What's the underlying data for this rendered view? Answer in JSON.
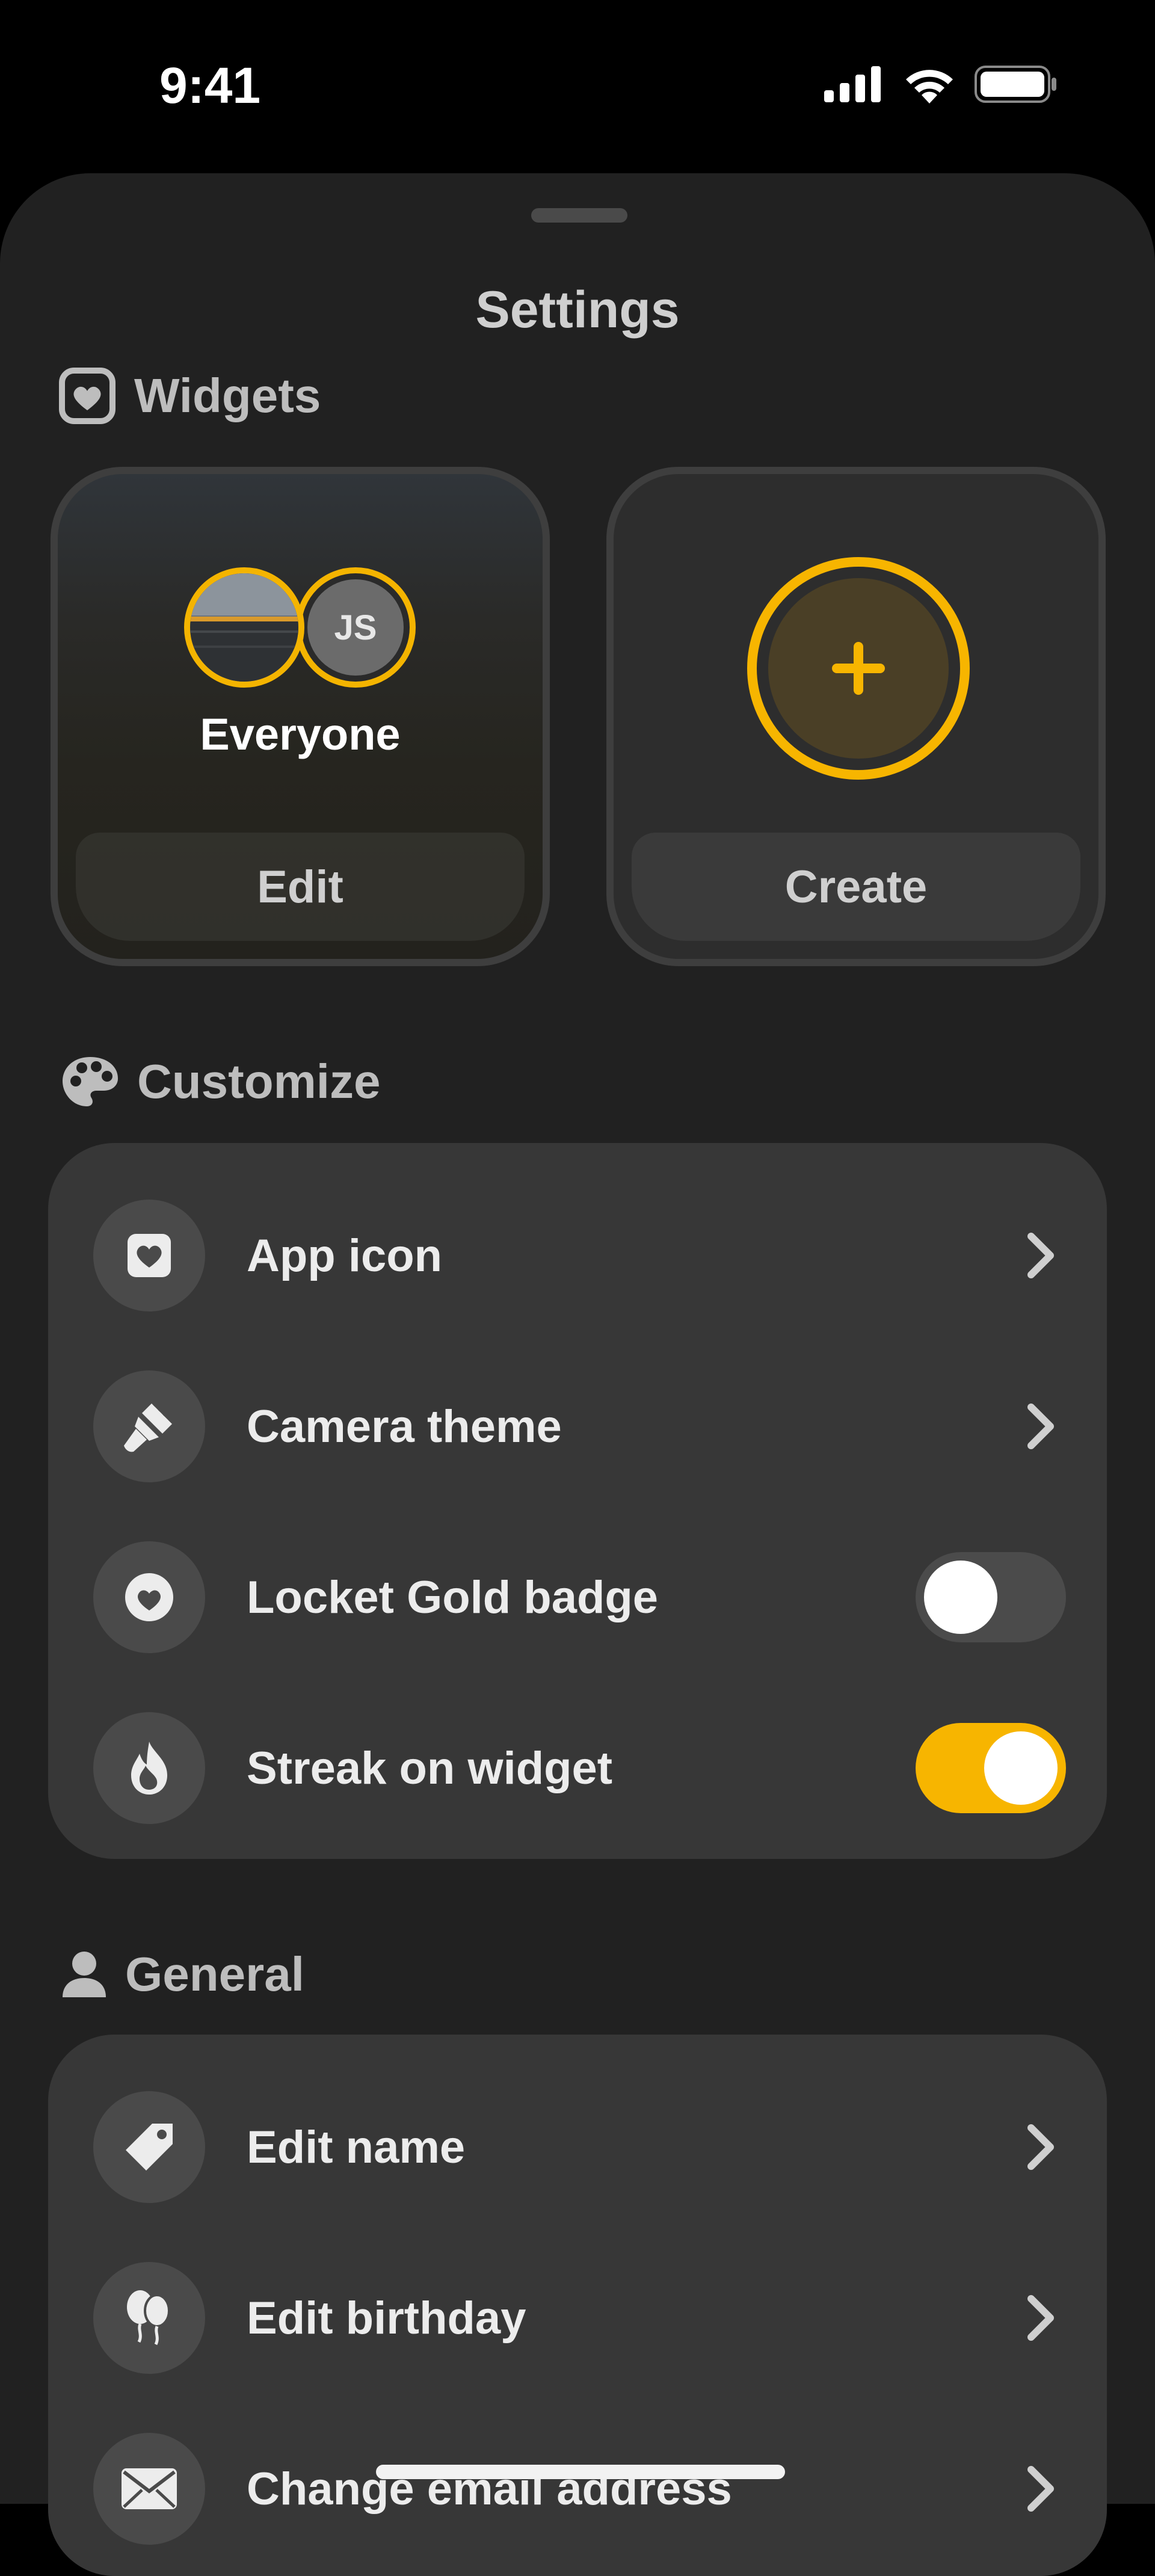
{
  "status_bar": {
    "time": "9:41"
  },
  "sheet": {
    "title": "Settings"
  },
  "widgets": {
    "header": "Widgets",
    "everyone_card": {
      "avatar_initials": "JS",
      "label": "Everyone",
      "button": "Edit"
    },
    "create_card": {
      "icon": "+",
      "button": "Create"
    }
  },
  "customize": {
    "header": "Customize",
    "items": [
      {
        "label": "App icon",
        "icon": "heart-square-icon",
        "control": "chevron"
      },
      {
        "label": "Camera theme",
        "icon": "paintbrush-icon",
        "control": "chevron"
      },
      {
        "label": "Locket Gold badge",
        "icon": "heart-badge-icon",
        "control": "toggle",
        "on": false
      },
      {
        "label": "Streak on widget",
        "icon": "flame-icon",
        "control": "toggle",
        "on": true
      }
    ]
  },
  "general": {
    "header": "General",
    "items": [
      {
        "label": "Edit name",
        "icon": "tag-icon",
        "control": "chevron"
      },
      {
        "label": "Edit birthday",
        "icon": "balloons-icon",
        "control": "chevron"
      },
      {
        "label": "Change email address",
        "icon": "envelope-icon",
        "control": "chevron"
      }
    ]
  },
  "colors": {
    "accent": "#F7B500",
    "background": "#212121",
    "card": "#373737"
  }
}
